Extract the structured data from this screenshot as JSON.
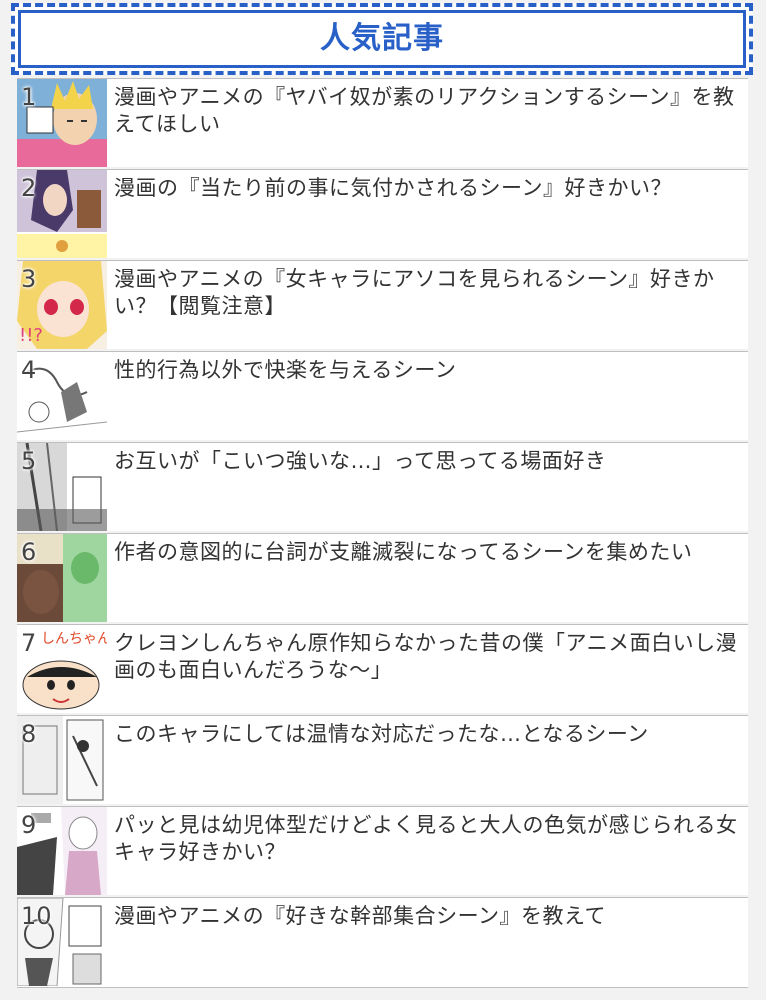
{
  "widget": {
    "title": "人気記事",
    "accent_color": "#2860c8",
    "items": [
      {
        "rank": "1",
        "title": "漫画やアニメの『ヤバイ奴が素のリアクションするシーン』を教えてほしい",
        "thumb_icon": "manga-thumbnail-icon"
      },
      {
        "rank": "2",
        "title": "漫画の『当たり前の事に気付かされるシーン』好きかい？",
        "thumb_icon": "manga-thumbnail-icon"
      },
      {
        "rank": "3",
        "title": "漫画やアニメの『女キャラにアソコを見られるシーン』好きかい？【閲覧注意】",
        "thumb_icon": "manga-thumbnail-icon"
      },
      {
        "rank": "4",
        "title": "性的行為以外で快楽を与えるシーン",
        "thumb_icon": "manga-thumbnail-icon"
      },
      {
        "rank": "5",
        "title": "お互いが「こいつ強いな…」って思ってる場面好き",
        "thumb_icon": "manga-thumbnail-icon"
      },
      {
        "rank": "6",
        "title": "作者の意図的に台詞が支離滅裂になってるシーンを集めたい",
        "thumb_icon": "manga-thumbnail-icon"
      },
      {
        "rank": "7",
        "title": "クレヨンしんちゃん原作知らなかった昔の僕「アニメ面白いし漫画のも面白いんだろうな〜」",
        "thumb_icon": "manga-thumbnail-icon"
      },
      {
        "rank": "8",
        "title": "このキャラにしては温情な対応だったな…となるシーン",
        "thumb_icon": "manga-thumbnail-icon"
      },
      {
        "rank": "9",
        "title": "パッと見は幼児体型だけどよく見ると大人の色気が感じられる女キャラ好きかい？",
        "thumb_icon": "manga-thumbnail-icon"
      },
      {
        "rank": "10",
        "title": "漫画やアニメの『好きな幹部集合シーン』を教えて",
        "thumb_icon": "manga-thumbnail-icon"
      }
    ]
  }
}
